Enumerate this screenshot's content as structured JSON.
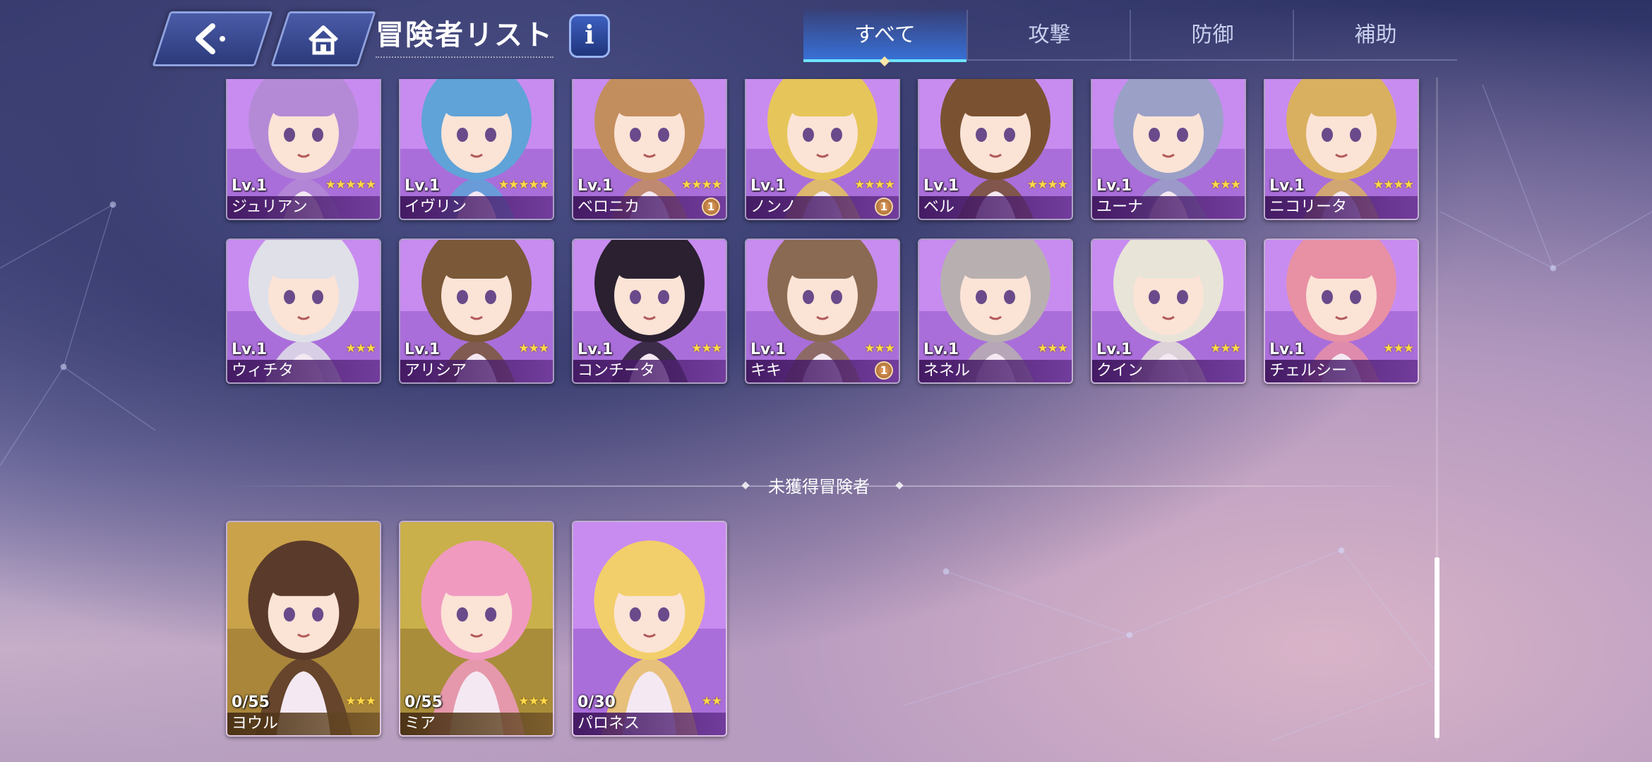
{
  "header": {
    "title": "冒険者リスト",
    "info_label": "i",
    "back_icon": "back-arrow-icon",
    "home_icon": "home-icon"
  },
  "tabs": [
    {
      "label": "すべて",
      "active": true
    },
    {
      "label": "攻撃",
      "active": false
    },
    {
      "label": "防御",
      "active": false
    },
    {
      "label": "補助",
      "active": false
    }
  ],
  "owned": [
    {
      "level": "Lv.1",
      "name": "ジュリアン",
      "stars": 5,
      "badge": null,
      "color": "#b48ad6"
    },
    {
      "level": "Lv.1",
      "name": "イヴリン",
      "stars": 5,
      "badge": null,
      "color": "#5fa3d8"
    },
    {
      "level": "Lv.1",
      "name": "ベロニカ",
      "stars": 4,
      "badge": "1",
      "color": "#c38e5e"
    },
    {
      "level": "Lv.1",
      "name": "ノンノ",
      "stars": 4,
      "badge": "1",
      "color": "#e6c65a"
    },
    {
      "level": "Lv.1",
      "name": "ベル",
      "stars": 4,
      "badge": null,
      "color": "#7a5232"
    },
    {
      "level": "Lv.1",
      "name": "ユーナ",
      "stars": 3,
      "badge": null,
      "color": "#9aa0c6"
    },
    {
      "level": "Lv.1",
      "name": "ニコリータ",
      "stars": 4,
      "badge": null,
      "color": "#d9b060"
    },
    {
      "level": "Lv.1",
      "name": "ウィチタ",
      "stars": 3,
      "badge": null,
      "color": "#e0e0e8"
    },
    {
      "level": "Lv.1",
      "name": "アリシア",
      "stars": 3,
      "badge": null,
      "color": "#7a5838"
    },
    {
      "level": "Lv.1",
      "name": "コンチータ",
      "stars": 3,
      "badge": null,
      "color": "#2a2030"
    },
    {
      "level": "Lv.1",
      "name": "キキ",
      "stars": 3,
      "badge": "1",
      "color": "#8a6a52"
    },
    {
      "level": "Lv.1",
      "name": "ネネル",
      "stars": 3,
      "badge": null,
      "color": "#b8b0b0"
    },
    {
      "level": "Lv.1",
      "name": "クイン",
      "stars": 3,
      "badge": null,
      "color": "#e8e4d8"
    },
    {
      "level": "Lv.1",
      "name": "チェルシー",
      "stars": 3,
      "badge": null,
      "color": "#e890a4"
    }
  ],
  "section": {
    "unowned_label": "未獲得冒険者"
  },
  "unowned": [
    {
      "progress": "0/55",
      "name": "ヨウル",
      "stars": 3,
      "color": "#5a3a2a",
      "bg": "#c9a24a"
    },
    {
      "progress": "0/55",
      "name": "ミア",
      "stars": 3,
      "color": "#f09ac0",
      "bg": "#c9b04a"
    },
    {
      "progress": "0/30",
      "name": "パロネス",
      "stars": 2,
      "color": "#f2cf6a",
      "bg": "#b88ad8"
    }
  ]
}
